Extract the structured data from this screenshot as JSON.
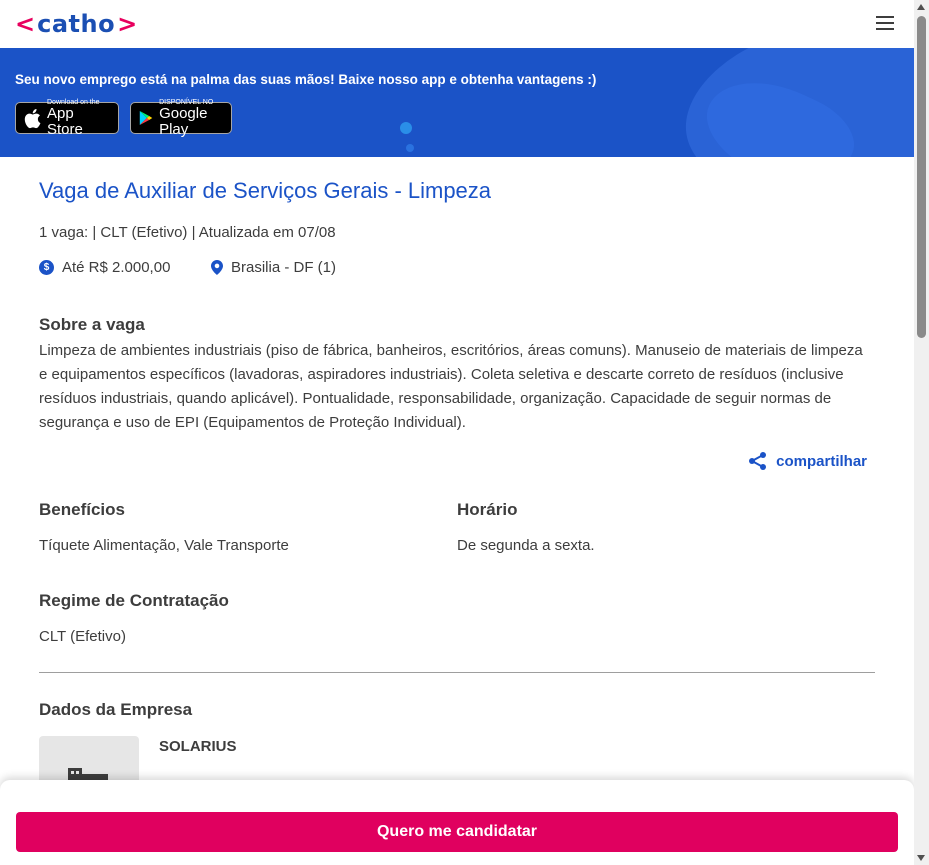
{
  "header": {
    "logo_left": "<",
    "logo_word": "catho",
    "logo_right": ">",
    "menu_icon": "hamburger-icon"
  },
  "banner": {
    "text": "Seu novo emprego está na palma das suas mãos! Baixe nosso app e obtenha vantagens :)",
    "app_store": {
      "small": "Download on the",
      "big": "App Store",
      "icon": "apple-icon"
    },
    "google_play": {
      "small": "DISPONÍVEL NO",
      "big": "Google Play",
      "icon": "google-play-icon"
    }
  },
  "job": {
    "title": "Vaga de Auxiliar de Serviços Gerais - Limpeza",
    "meta": "1 vaga: | CLT (Efetivo) | Atualizada em 07/08",
    "salary": "Até R$ 2.000,00",
    "location": "Brasilia - DF (1)"
  },
  "about": {
    "heading": "Sobre a vaga",
    "text": "Limpeza de ambientes industriais (piso de fábrica, banheiros, escritórios, áreas comuns). Manuseio de materiais de limpeza e equipamentos específicos (lavadoras, aspiradores industriais). Coleta seletiva e descarte correto de resíduos (inclusive resíduos industriais, quando aplicável). Pontualidade, responsabilidade, organização. Capacidade de seguir normas de segurança e uso de EPI (Equipamentos de Proteção Individual)."
  },
  "share": {
    "label": "compartilhar",
    "icon": "share-icon"
  },
  "benefits": {
    "heading": "Benefícios",
    "text": "Tíquete Alimentação, Vale Transporte"
  },
  "schedule": {
    "heading": "Horário",
    "text": "De segunda a sexta."
  },
  "contract": {
    "heading": "Regime de Contratação",
    "text": "CLT (Efetivo)"
  },
  "company": {
    "heading": "Dados da Empresa",
    "name": "SOLARIUS",
    "logo_icon": "building-icon"
  },
  "cta": {
    "label": "Quero me candidatar"
  },
  "colors": {
    "brand_blue": "#1b53c7",
    "brand_pink": "#e0005f"
  }
}
